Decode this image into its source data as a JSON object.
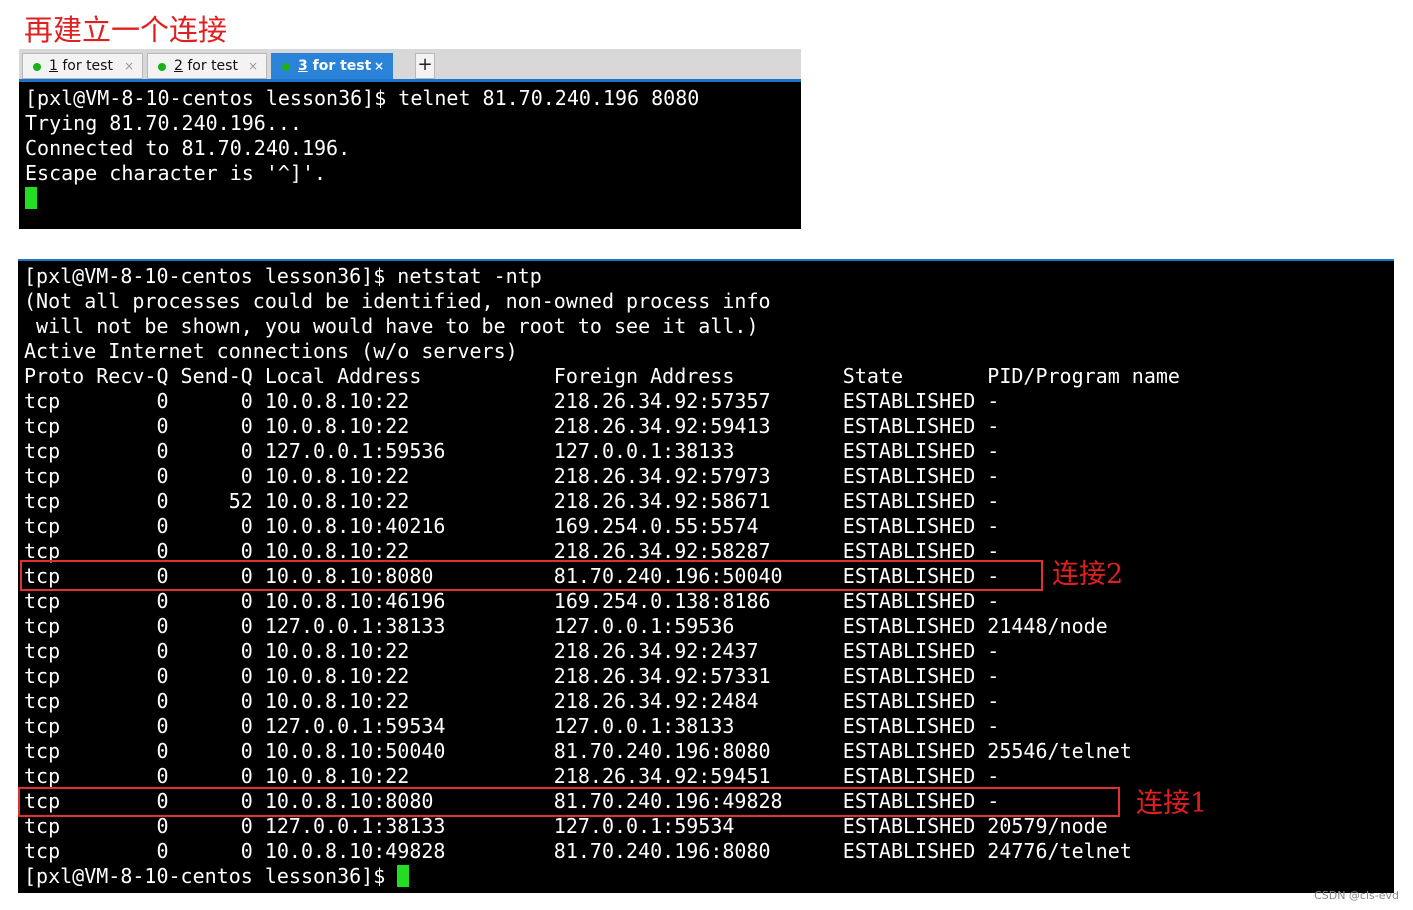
{
  "heading": "再建立一个连接",
  "tabs": [
    {
      "num": "1",
      "label": " for test",
      "active": false
    },
    {
      "num": "2",
      "label": " for test",
      "active": false
    },
    {
      "num": "3",
      "label": " for test",
      "active": true
    }
  ],
  "tab_close": "×",
  "tab_add": "+",
  "terminal1": {
    "lines": [
      "[pxl@VM-8-10-centos lesson36]$ telnet 81.70.240.196 8080",
      "Trying 81.70.240.196...",
      "Connected to 81.70.240.196.",
      "Escape character is '^]'."
    ]
  },
  "terminal2": {
    "lines": [
      "[pxl@VM-8-10-centos lesson36]$ netstat -ntp",
      "(Not all processes could be identified, non-owned process info",
      " will not be shown, you would have to be root to see it all.)",
      "Active Internet connections (w/o servers)",
      "Proto Recv-Q Send-Q Local Address           Foreign Address         State       PID/Program name",
      "tcp        0      0 10.0.8.10:22            218.26.34.92:57357      ESTABLISHED -",
      "tcp        0      0 10.0.8.10:22            218.26.34.92:59413      ESTABLISHED -",
      "tcp        0      0 127.0.0.1:59536         127.0.0.1:38133         ESTABLISHED -",
      "tcp        0      0 10.0.8.10:22            218.26.34.92:57973      ESTABLISHED -",
      "tcp        0     52 10.0.8.10:22            218.26.34.92:58671      ESTABLISHED -",
      "tcp        0      0 10.0.8.10:40216         169.254.0.55:5574       ESTABLISHED -",
      "tcp        0      0 10.0.8.10:22            218.26.34.92:58287      ESTABLISHED -",
      "tcp        0      0 10.0.8.10:8080          81.70.240.196:50040     ESTABLISHED -",
      "tcp        0      0 10.0.8.10:46196         169.254.0.138:8186      ESTABLISHED -",
      "tcp        0      0 127.0.0.1:38133         127.0.0.1:59536         ESTABLISHED 21448/node",
      "tcp        0      0 10.0.8.10:22            218.26.34.92:2437       ESTABLISHED -",
      "tcp        0      0 10.0.8.10:22            218.26.34.92:57331      ESTABLISHED -",
      "tcp        0      0 10.0.8.10:22            218.26.34.92:2484       ESTABLISHED -",
      "tcp        0      0 127.0.0.1:59534         127.0.0.1:38133         ESTABLISHED -",
      "tcp        0      0 10.0.8.10:50040         81.70.240.196:8080      ESTABLISHED 25546/telnet",
      "tcp        0      0 10.0.8.10:22            218.26.34.92:59451      ESTABLISHED -",
      "tcp        0      0 10.0.8.10:8080          81.70.240.196:49828     ESTABLISHED -",
      "tcp        0      0 127.0.0.1:38133         127.0.0.1:59534         ESTABLISHED 20579/node",
      "tcp        0      0 10.0.8.10:49828         81.70.240.196:8080      ESTABLISHED 24776/telnet"
    ],
    "prompt": "[pxl@VM-8-10-centos lesson36]$ "
  },
  "annotations": {
    "conn2": "连接2",
    "conn1": "连接1"
  },
  "watermark": "CSDN @cls-evd",
  "colors": {
    "annotation_red": "#e02020",
    "cursor_green": "#22dd22",
    "tab_active_blue": "#2b82d9"
  }
}
